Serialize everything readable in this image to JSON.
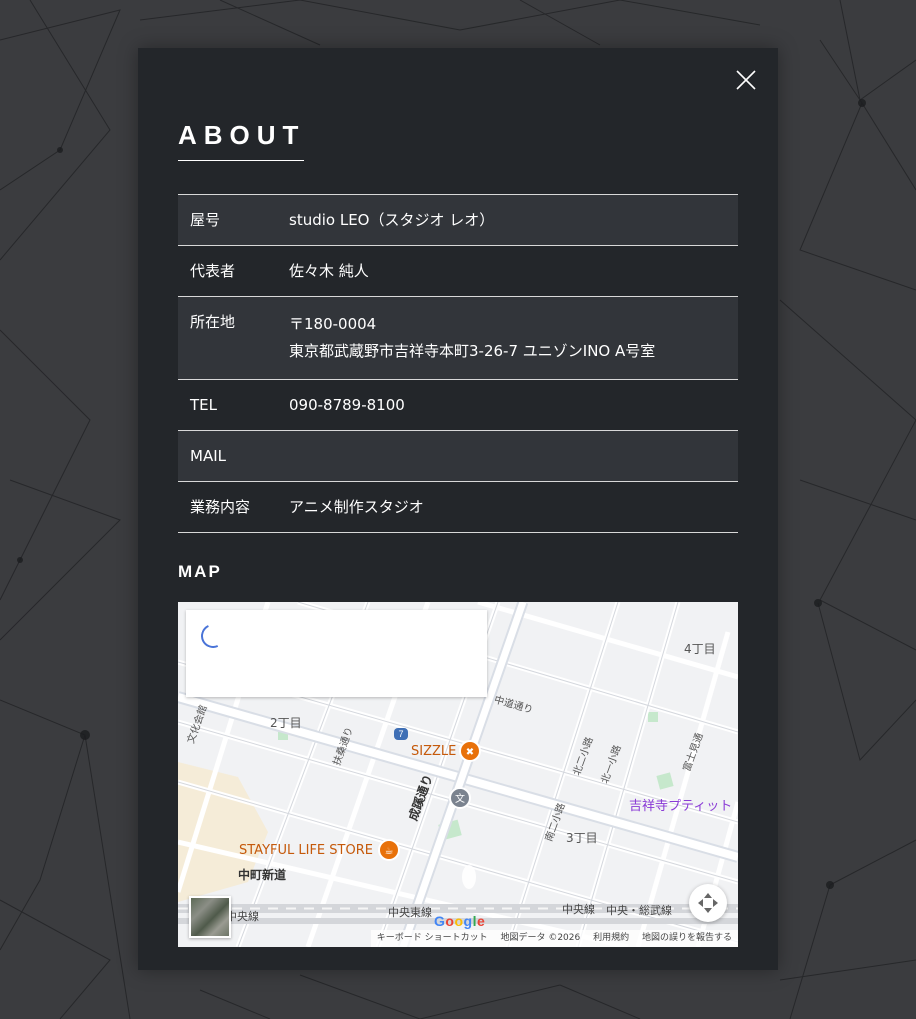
{
  "about": {
    "title": "ABOUT",
    "rows": [
      {
        "label": "屋号",
        "value": "studio LEO（スタジオ レオ）"
      },
      {
        "label": "代表者",
        "value": "佐々木 純人"
      },
      {
        "label": "所在地",
        "postal": "〒180-0004",
        "address": "東京都武蔵野市吉祥寺本町3-26-7 ユニゾンINO A号室"
      },
      {
        "label": "TEL",
        "value": "090-8789-8100"
      },
      {
        "label": "MAIL",
        "value": ""
      },
      {
        "label": "業務内容",
        "value": "アニメ制作スタジオ"
      }
    ]
  },
  "map": {
    "title": "MAP",
    "labels": {
      "area_4chome": "4丁目",
      "area_2chome": "2丁目",
      "area_3chome": "3丁目",
      "sizzle": "SIZZLE",
      "stayful": "STAYFUL LIFE STORE",
      "kichijoji_boutique": "吉祥寺プティット",
      "nakamachi": "中町新道",
      "chuo_line_left": "中央線",
      "chuo_tozai_line": "中央東線",
      "chuo_line_right": "中央線",
      "chuo_sobu_line": "中央・総武線",
      "seikei_dori": "成蹊通り",
      "nakamichi_dori": "中道通り",
      "kitanishi_koji": "北二小路",
      "kita_ichi_koji": "北一小路",
      "fujimi_dori": "富士見通",
      "fusou_dori": "扶桑通り",
      "bunka_kaikan": "文化会館",
      "minami_ni_koji": "南二小路",
      "route_badge": "7",
      "google": "Google"
    },
    "attribution": {
      "shortcuts": "キーボード ショートカット",
      "map_data": "地図データ ©2026",
      "terms": "利用規約",
      "report": "地図の誤りを報告する"
    }
  },
  "colors": {
    "modal_bg": "#23262a",
    "row_shade": "#32353a",
    "poi_orange": "#e8710a",
    "poi_purple": "#8a3bd6",
    "map_bg": "#f1f2f4"
  },
  "icons": {
    "close": "close-icon",
    "fullscreen": "fullscreen-icon",
    "spinner": "loading-spinner-icon",
    "restaurant": "restaurant-icon",
    "cafe": "cafe-icon",
    "school": "school-icon"
  }
}
